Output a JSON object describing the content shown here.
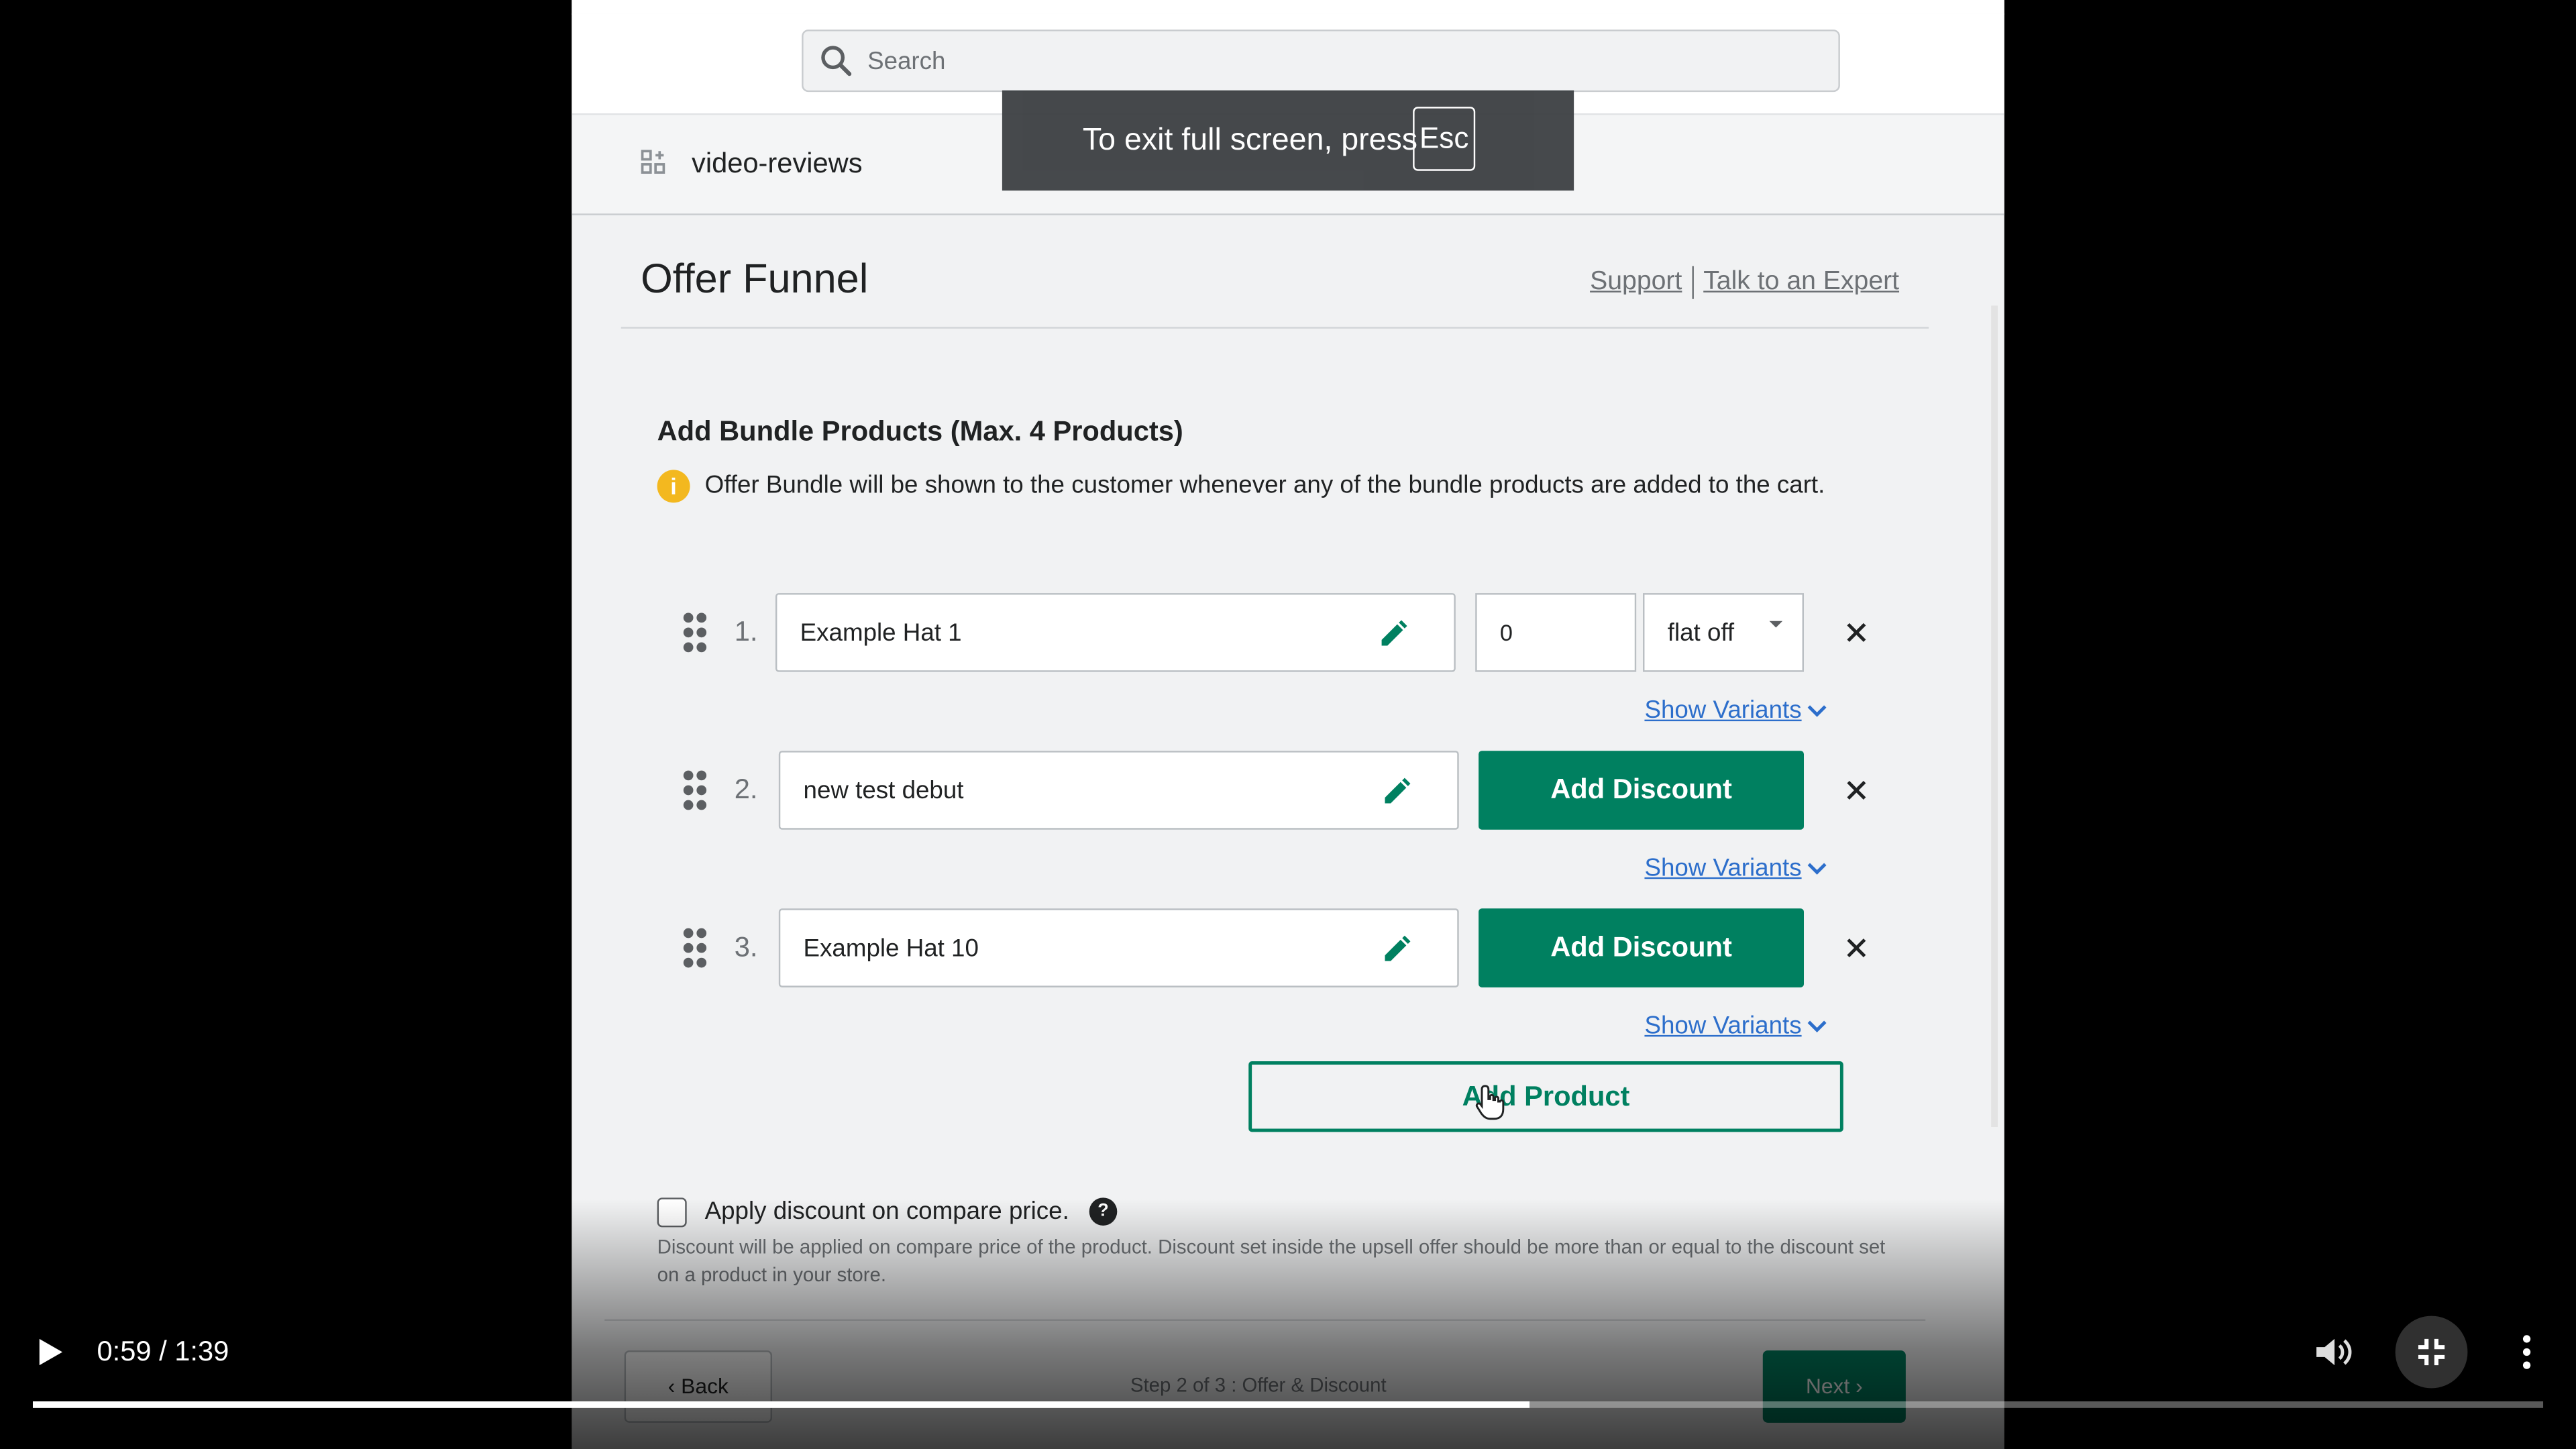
{
  "search": {
    "placeholder": "Search"
  },
  "app": {
    "name": "video-reviews"
  },
  "page": {
    "title": "Offer Funnel",
    "support_link": "Support",
    "expert_link": "Talk to an Expert"
  },
  "bundle": {
    "heading": "Add Bundle Products (Max. 4 Products)",
    "info": "Offer Bundle will be shown to the customer whenever any of the bundle products are added to the cart.",
    "products": [
      {
        "index": "1.",
        "name": "Example Hat 1",
        "discount_value": "0",
        "discount_type": "flat off",
        "show_variants": "Show Variants"
      },
      {
        "index": "2.",
        "name": "new test debut",
        "add_discount": "Add Discount",
        "show_variants": "Show Variants"
      },
      {
        "index": "3.",
        "name": "Example Hat 10",
        "add_discount": "Add Discount",
        "show_variants": "Show Variants"
      }
    ],
    "add_product": "Add Product"
  },
  "compare": {
    "label": "Apply discount on compare price.",
    "help": "Discount will be applied on compare price of the product. Discount set inside the upsell offer should be more than or equal to the discount set on a product in your store."
  },
  "footer": {
    "back": "Back",
    "step": "Step 2 of 3 : Offer & Discount",
    "next": "Next"
  },
  "toast": {
    "text": "To exit full screen, press",
    "key": "Esc"
  },
  "video": {
    "time": "0:59 / 1:39",
    "progress": 0.596
  },
  "colors": {
    "accent": "#008060",
    "link": "#2c6ecb",
    "info": "#f3b81f"
  }
}
